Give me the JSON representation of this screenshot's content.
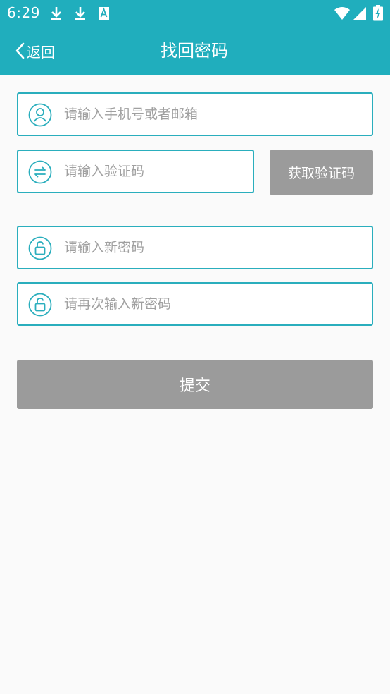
{
  "status_bar": {
    "time": "6:29",
    "icons": [
      "download-icon",
      "download-icon",
      "accessibility-a-icon",
      "wifi-icon",
      "signal-icon",
      "battery-charging-icon"
    ]
  },
  "header": {
    "back_label": "返回",
    "title": "找回密码",
    "background_color": "#20aebd"
  },
  "form": {
    "account_placeholder": "请输入手机号或者邮箱",
    "code_placeholder": "请输入验证码",
    "get_code_label": "获取验证码",
    "new_password_placeholder": "请输入新密码",
    "confirm_password_placeholder": "请再次输入新密码",
    "submit_label": "提交",
    "accent_color": "#2aaebd",
    "disabled_button_color": "#9b9b9b"
  }
}
